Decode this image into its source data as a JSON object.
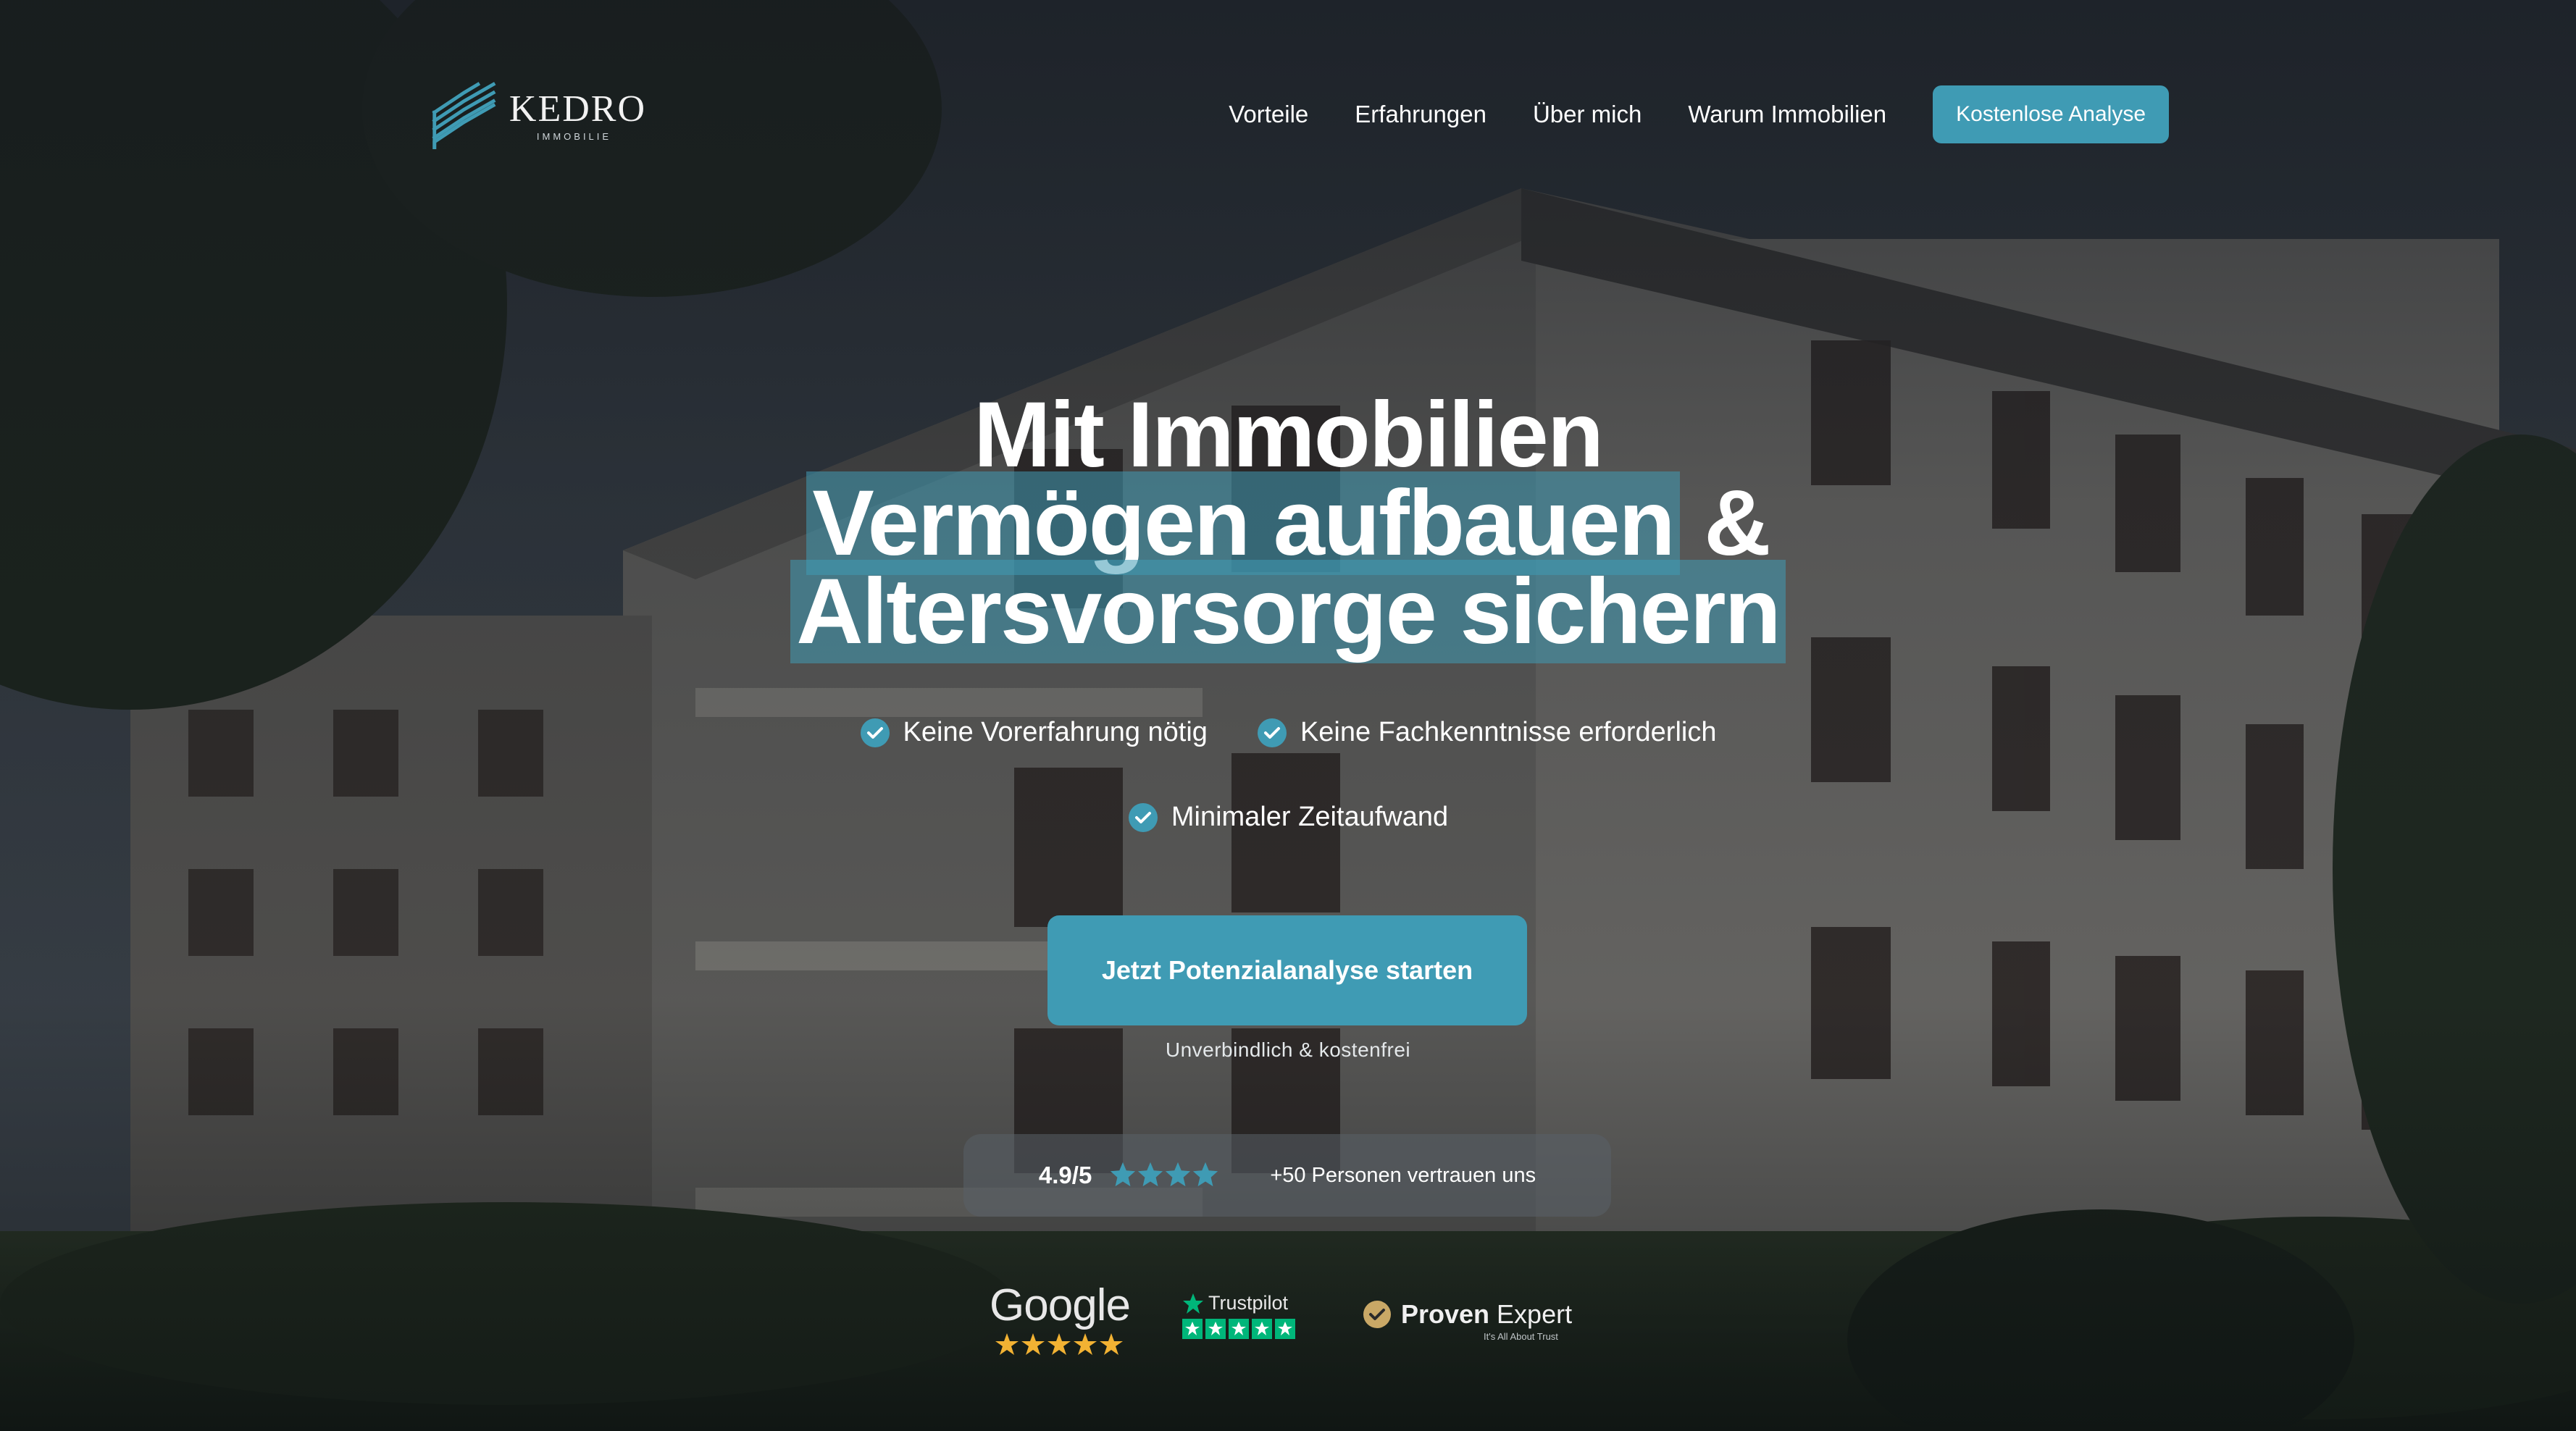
{
  "brand": {
    "name": "KEDRO",
    "subtitle": "IMMOBILIE"
  },
  "nav": {
    "items": [
      {
        "label": "Vorteile"
      },
      {
        "label": "Erfahrungen"
      },
      {
        "label": "Über mich"
      },
      {
        "label": "Warum Immobilien"
      }
    ],
    "cta_label": "Kostenlose Analyse"
  },
  "hero": {
    "title_line1": "Mit Immobilien",
    "title_line2_highlight": "Vermögen aufbauen",
    "title_line2_rest": " &",
    "title_line3_highlight": "Altersvorsorge sichern",
    "checks": [
      {
        "label": "Keine Vorerfahrung nötig",
        "icon": "check-circle-icon"
      },
      {
        "label": "Keine Fachkenntnisse erforderlich",
        "icon": "check-circle-icon"
      },
      {
        "label": "Minimaler Zeitaufwand",
        "icon": "check-circle-icon"
      }
    ],
    "cta_label": "Jetzt Potenzialanalyse starten",
    "cta_note": "Unverbindlich & kostenfrei"
  },
  "rating": {
    "score": "4.9/5",
    "stars": 4.5,
    "text": "+50 Personen vertrauen uns"
  },
  "badges": {
    "google": {
      "label": "Google",
      "stars": 5
    },
    "trustpilot": {
      "label": "Trustpilot",
      "stars": 5
    },
    "provenexpert": {
      "label_bold": "Proven",
      "label_rest": " Expert",
      "tagline": "It's All About Trust"
    }
  },
  "colors": {
    "accent": "#3f9bb4",
    "star_rating": "#3f9bb4",
    "google_star": "#f2b233",
    "trustpilot_green": "#00b67a",
    "proven_gold": "#c9a866"
  }
}
